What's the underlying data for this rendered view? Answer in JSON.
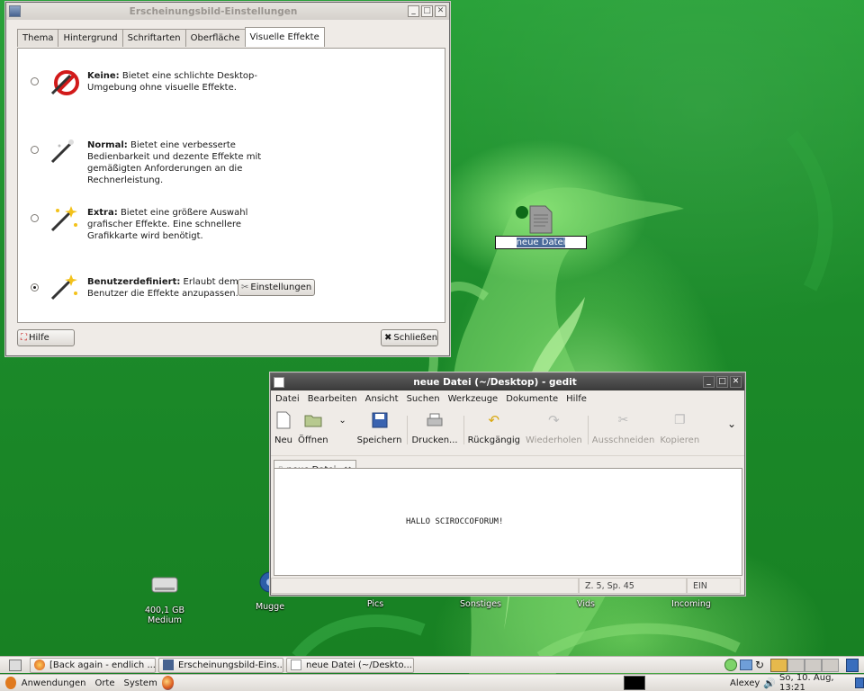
{
  "appearance": {
    "title": "Erscheinungsbild-Einstellungen",
    "tabs": [
      "Thema",
      "Hintergrund",
      "Schriftarten",
      "Oberfläche",
      "Visuelle Effekte"
    ],
    "options": [
      {
        "bold": "Keine:",
        "text": "Bietet eine schlichte Desktop-Umgebung ohne visuelle Effekte.",
        "selected": false
      },
      {
        "bold": "Normal:",
        "text": "Bietet eine verbesserte Bedienbarkeit und dezente Effekte mit gemäßigten Anforderungen an die Rechnerleistung.",
        "selected": false
      },
      {
        "bold": "Extra:",
        "text": "Bietet eine größere Auswahl grafischer Effekte. Eine schnellere Grafikkarte wird benötigt.",
        "selected": false
      },
      {
        "bold": "Benutzerdefiniert:",
        "text": "Erlaubt dem Benutzer die Effekte anzupassen.",
        "selected": true
      }
    ],
    "settings_button": "Einstellungen",
    "help_button": "Hilfe",
    "close_button": "Schließen"
  },
  "desktop_file": {
    "label": "neue Datei"
  },
  "gedit": {
    "title": "neue Datei (~/Desktop) - gedit",
    "menu": [
      "Datei",
      "Bearbeiten",
      "Ansicht",
      "Suchen",
      "Werkzeuge",
      "Dokumente",
      "Hilfe"
    ],
    "toolbar": [
      {
        "label": "Neu",
        "icon": "new-file-icon",
        "enabled": true
      },
      {
        "label": "Öffnen",
        "icon": "open-folder-icon",
        "enabled": true
      },
      {
        "label": "Speichern",
        "icon": "save-icon",
        "enabled": true
      },
      {
        "label": "Drucken...",
        "icon": "printer-icon",
        "enabled": true
      },
      {
        "label": "Rückgängig",
        "icon": "undo-icon",
        "enabled": true
      },
      {
        "label": "Wiederholen",
        "icon": "redo-icon",
        "enabled": false
      },
      {
        "label": "Ausschneiden",
        "icon": "cut-icon",
        "enabled": false
      },
      {
        "label": "Kopieren",
        "icon": "copy-icon",
        "enabled": false
      }
    ],
    "doc_tab": "neue Datei",
    "content": "HALLO SCIROCCOFORUM!",
    "status_position": "Z. 5, Sp. 45",
    "status_mode": "EIN"
  },
  "desktop_icons": [
    "400,1 GB Medium",
    "Mugge",
    "Pics",
    "Sonstiges",
    "Vids",
    "Incoming"
  ],
  "taskbar": [
    {
      "label": "[Back again - endlich ...",
      "icon": "firefox-icon"
    },
    {
      "label": "Erscheinungsbild-Eins...",
      "icon": "appearance-icon"
    },
    {
      "label": "neue Datei (~/Deskto...",
      "icon": "gedit-icon"
    }
  ],
  "top_panel": {
    "menus": [
      "Anwendungen",
      "Orte",
      "System"
    ],
    "user": "Alexey",
    "clock": "So, 10. Aug, 13:21"
  }
}
